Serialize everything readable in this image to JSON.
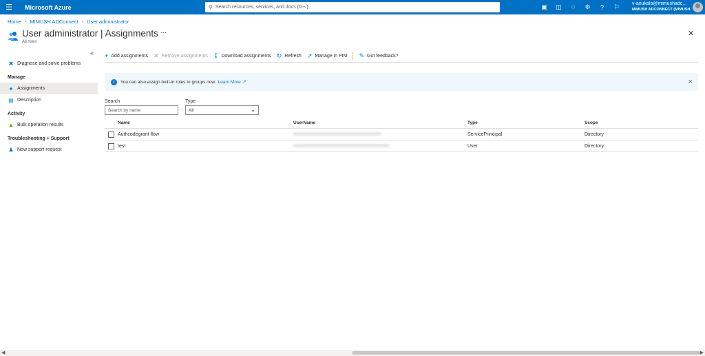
{
  "topbar": {
    "brand": "Microsoft Azure",
    "search_placeholder": "Search resources, services, and docs (G+/)",
    "icons": [
      "cloud-shell-icon",
      "directory-filter-icon",
      "notifications-icon",
      "settings-icon",
      "help-icon",
      "feedback-icon"
    ],
    "account_name": "v-anukala@mimushadc...",
    "account_tenant": "MIMUSH ADCONNECT (MIMUSH..."
  },
  "breadcrumb": [
    "Home",
    "MIMUSH ADConnect",
    "User administrator"
  ],
  "header": {
    "title": "User administrator",
    "separator": "|",
    "section": "Assignments",
    "subtitle": "All roles",
    "more": "···"
  },
  "sidebar": {
    "collapse": "«",
    "top_item": "Diagnose and solve problems",
    "groups": [
      {
        "heading": "Manage",
        "items": [
          "Assignments",
          "Description"
        ]
      },
      {
        "heading": "Activity",
        "items": [
          "Bulk operation results"
        ]
      },
      {
        "heading": "Troubleshooting + Support",
        "items": [
          "New support request"
        ]
      }
    ]
  },
  "toolbar": {
    "add": "Add assignments",
    "remove": "Remove assignments",
    "download": "Download assignments",
    "refresh": "Refresh",
    "pim": "Manage in PIM",
    "feedback": "Got feedback?"
  },
  "info": {
    "text": "You can also assign built-in roles to groups now.",
    "link": "Learn More"
  },
  "filters": {
    "search_label": "Search",
    "search_placeholder": "Search by name",
    "type_label": "Type",
    "type_value": "All"
  },
  "table": {
    "columns": [
      "Name",
      "UserName",
      "Type",
      "Scope"
    ],
    "rows": [
      {
        "name": "Authcodegrant flow",
        "username": "",
        "type": "ServicePrincipal",
        "scope": "Directory"
      },
      {
        "name": "test",
        "username": "",
        "type": "User",
        "scope": "Directory"
      }
    ]
  },
  "colors": {
    "topbar": "#0072c6",
    "accent": "#0078d4",
    "info_bg": "#eff6fc",
    "sidebar_active": "#edebe9"
  }
}
